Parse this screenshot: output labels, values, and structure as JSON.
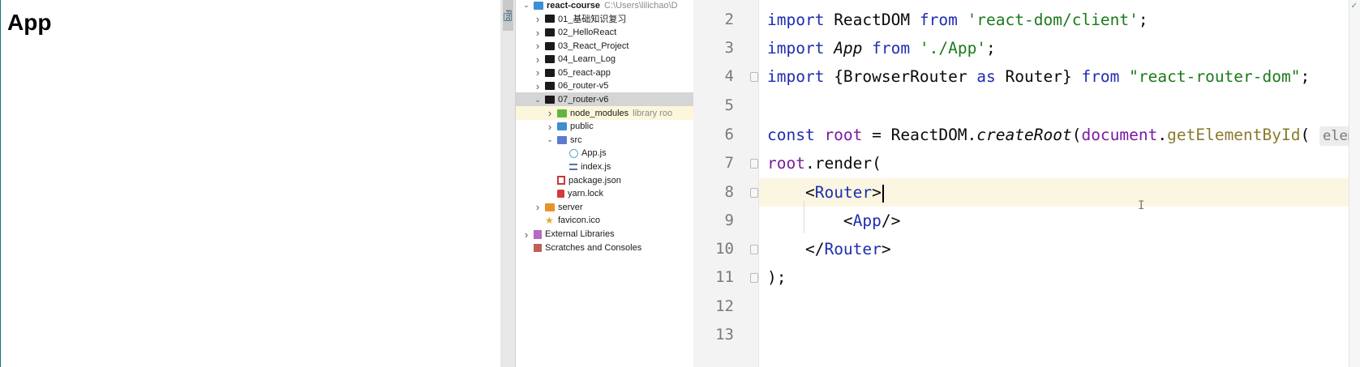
{
  "browser": {
    "heading": "App"
  },
  "ide": {
    "side_tab": "Pro",
    "tree": [
      {
        "id": "react-course",
        "label": "react-course",
        "hint": "C:\\Users\\lilichao\\D",
        "chevron": "down",
        "icon": "project-folder-icon",
        "bold": true
      },
      {
        "id": "01",
        "label": "01_基础知识复习",
        "chevron": "right",
        "icon": "folder-icon"
      },
      {
        "id": "02",
        "label": "02_HelloReact",
        "chevron": "right",
        "icon": "folder-icon"
      },
      {
        "id": "03",
        "label": "03_React_Project",
        "chevron": "right",
        "icon": "folder-icon"
      },
      {
        "id": "04",
        "label": "04_Learn_Log",
        "chevron": "right",
        "icon": "folder-icon"
      },
      {
        "id": "05",
        "label": "05_react-app",
        "chevron": "right",
        "icon": "folder-icon"
      },
      {
        "id": "06",
        "label": "06_router-v5",
        "chevron": "right",
        "icon": "folder-icon"
      },
      {
        "id": "07",
        "label": "07_router-v6",
        "chevron": "down",
        "icon": "folder-icon",
        "selected": true
      },
      {
        "id": "node_modules",
        "label": "node_modules",
        "hint": "library roo",
        "chevron": "right",
        "icon": "library-folder-icon"
      },
      {
        "id": "public",
        "label": "public",
        "chevron": "right",
        "icon": "public-folder-icon"
      },
      {
        "id": "src",
        "label": "src",
        "chevron": "down",
        "icon": "source-folder-icon"
      },
      {
        "id": "appjs",
        "label": "App.js",
        "icon": "react-file-icon"
      },
      {
        "id": "indexjs",
        "label": "index.js",
        "icon": "js-file-icon"
      },
      {
        "id": "packagejson",
        "label": "package.json",
        "icon": "npm-file-icon"
      },
      {
        "id": "yarnlock",
        "label": "yarn.lock",
        "icon": "lock-file-icon"
      },
      {
        "id": "server",
        "label": "server",
        "chevron": "right",
        "icon": "server-folder-icon"
      },
      {
        "id": "favicon",
        "label": "favicon.ico",
        "icon": "favicon-icon"
      },
      {
        "id": "extlib",
        "label": "External Libraries",
        "chevron": "right",
        "icon": "library-icon"
      },
      {
        "id": "scratches",
        "label": "Scratches and Consoles",
        "icon": "scratches-icon"
      }
    ],
    "line_numbers": [
      "2",
      "3",
      "4",
      "5",
      "6",
      "7",
      "8",
      "9",
      "10",
      "11",
      "12",
      "13"
    ],
    "code": {
      "l2": {
        "import": "import",
        "name": " ReactDOM ",
        "from": "from",
        "str": " 'react-dom/client'",
        "end": ";"
      },
      "l3": {
        "import": "import",
        "name": " App ",
        "from": "from",
        "str": " './App'",
        "end": ";"
      },
      "l4": {
        "import": "import",
        "open": " {BrowserRouter ",
        "as": "as",
        "alias": " Router} ",
        "from": "from",
        "str": " \"react-router-dom\"",
        "end": ";"
      },
      "l6": {
        "const": "const",
        "root": " root",
        "eq": " = ReactDOM.",
        "method": "createRoot",
        "paren": "(",
        "doc": "document",
        "dot": ".",
        "get": "getElementById",
        "paren2": "(",
        "hint": "elem"
      },
      "l7": {
        "root": "root",
        "rest": ".render("
      },
      "l8": {
        "open": "<",
        "tag": "Router",
        "close": ">"
      },
      "l9": {
        "open": "<",
        "tag": "App",
        "close": "/>"
      },
      "l10": {
        "open": "</",
        "tag": "Router",
        "close": ">"
      },
      "l11": {
        "text": ");"
      }
    }
  }
}
